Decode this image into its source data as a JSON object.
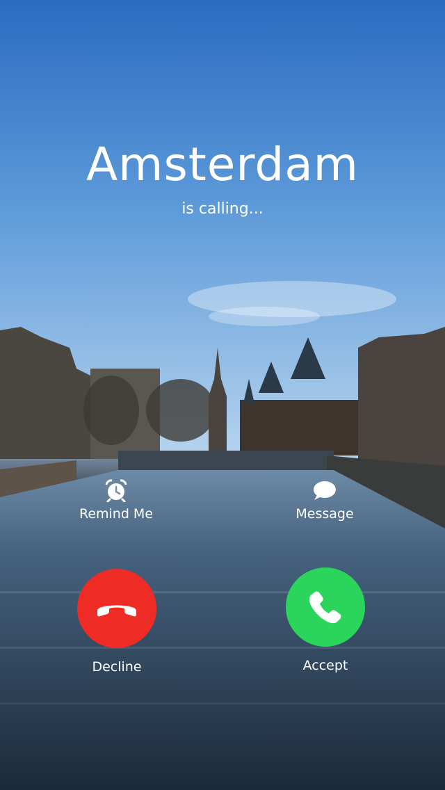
{
  "caller": {
    "name": "Amsterdam",
    "status": "is calling..."
  },
  "actions": {
    "remind_label": "Remind Me",
    "message_label": "Message"
  },
  "buttons": {
    "decline_label": "Decline",
    "accept_label": "Accept"
  },
  "colors": {
    "decline": "#ef2b25",
    "accept": "#2bd45a"
  },
  "icons": {
    "remind": "alarm-clock-icon",
    "message": "speech-bubble-icon",
    "decline": "phone-hangup-icon",
    "accept": "phone-icon"
  }
}
